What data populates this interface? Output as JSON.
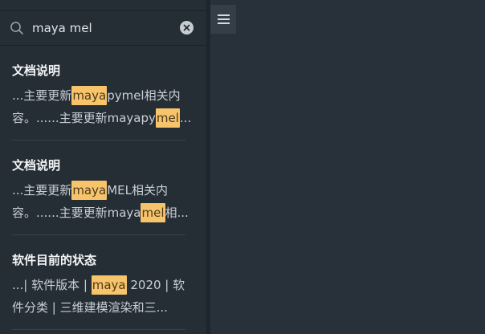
{
  "search": {
    "value": "maya mel",
    "icon": "search-icon",
    "clear_icon": "clear-icon"
  },
  "results": [
    {
      "title": "文档说明",
      "lines": [
        [
          {
            "text": "...主要更新",
            "hl": false
          },
          {
            "text": "maya",
            "hl": true
          },
          {
            "text": "pymel相关内",
            "hl": false
          }
        ],
        [
          {
            "text": "容。......主要更新mayapy",
            "hl": false
          },
          {
            "text": "mel",
            "hl": true
          },
          {
            "text": "...",
            "hl": false
          }
        ]
      ]
    },
    {
      "title": "文档说明",
      "lines": [
        [
          {
            "text": "...主要更新",
            "hl": false
          },
          {
            "text": "maya",
            "hl": true
          },
          {
            "text": "MEL相关内",
            "hl": false
          }
        ],
        [
          {
            "text": "容。......主要更新maya",
            "hl": false
          },
          {
            "text": "mel",
            "hl": true
          },
          {
            "text": "相...",
            "hl": false
          }
        ]
      ]
    },
    {
      "title": "软件目前的状态",
      "lines": [
        [
          {
            "text": "...| 软件版本 | ",
            "hl": false
          },
          {
            "text": "maya",
            "hl": true
          },
          {
            "text": " 2020 | 软",
            "hl": false
          }
        ],
        [
          {
            "text": "件分类 | 三维建模渲染和三...",
            "hl": false
          }
        ]
      ]
    }
  ],
  "toolbar": {
    "menu_icon": "hamburger-menu-icon"
  },
  "colors": {
    "highlight": "#f7c46b",
    "sidebar_bg": "#252d35",
    "main_bg": "#28313a"
  }
}
